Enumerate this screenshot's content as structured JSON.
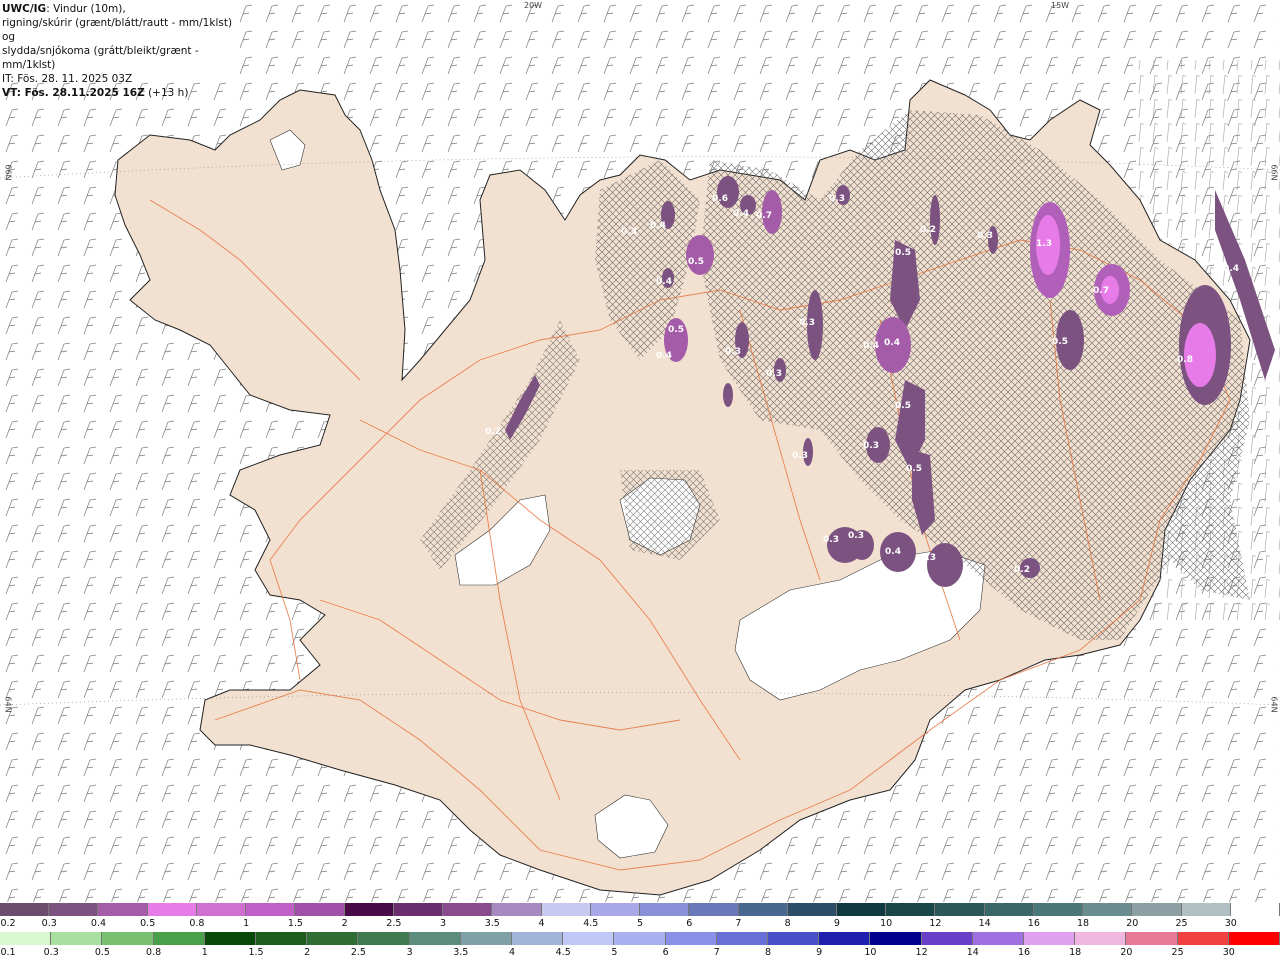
{
  "header": {
    "model": "UWC/IG",
    "line1_rest": ": Vindur (10m),",
    "line2": "rigning/skúrir (grænt/blátt/rautt - mm/1klst) og",
    "line3": "slydda/snjókoma (grátt/bleikt/grænt - mm/1klst)",
    "line4": "IT: Fös. 28. 11. 2025 03Z",
    "line5_bold": "VT: Fös. 28.11.2025 16Z",
    "line5_rest": " (+13 h)"
  },
  "grid_labels": {
    "top_20w": "20W",
    "top_15w": "15W",
    "left_66n": "66N",
    "left_64n": "64N",
    "right_66n": "66N",
    "right_64n": "64N"
  },
  "precip_values": [
    "0.6",
    "0.4",
    "0.7",
    "0.3",
    "0.5",
    "0.5",
    "1.3",
    "0.7",
    "0.5",
    "0.8",
    "0.4",
    "0.4",
    "0.5",
    "0.4",
    "0.4",
    "0.4",
    "0.3",
    "0.3",
    "0.3",
    "0.3",
    "0.3",
    "0.5",
    "0.5",
    "0.3",
    "0.3",
    "0.4",
    "0.3",
    "0.2",
    "0.2",
    "0.3",
    "0.2",
    "0.4",
    "0.3"
  ],
  "legend_snow": {
    "labels": [
      "0.2",
      "0.3",
      "0.4",
      "0.5",
      "0.8",
      "1",
      "1.5",
      "2",
      "2.5",
      "3",
      "3.5",
      "4",
      "4.5",
      "5",
      "6",
      "7",
      "8",
      "9",
      "10",
      "12",
      "14",
      "16",
      "18",
      "20",
      "25",
      "30"
    ],
    "colors": [
      "#6b4c6e",
      "#7c5380",
      "#a45ba8",
      "#e77ce8",
      "#d070d0",
      "#c060c8",
      "#a050a8",
      "#4a0a48",
      "#6a2e6e",
      "#8a4a8e",
      "#a888c0",
      "#c8c8f0",
      "#a8a8e8",
      "#8890d8",
      "#6878b8",
      "#486890",
      "#2c4e66",
      "#103840",
      "#1a4848",
      "#2a5858",
      "#3a6868",
      "#4a7878",
      "#6a8c8e",
      "#8ca0a4",
      "#b0c0c2",
      "#ffffff"
    ]
  },
  "legend_rain": {
    "labels": [
      "0.1",
      "0.3",
      "0.5",
      "0.8",
      "1",
      "1.5",
      "2",
      "2.5",
      "3",
      "3.5",
      "4",
      "4.5",
      "5",
      "6",
      "7",
      "8",
      "9",
      "10",
      "12",
      "14",
      "16",
      "18",
      "20",
      "25",
      "30"
    ],
    "colors": [
      "#d8f8d0",
      "#a8e0a0",
      "#78c070",
      "#48a048",
      "#084808",
      "#1c5c1c",
      "#2e6e34",
      "#3e7c50",
      "#5c8c7c",
      "#80a0a8",
      "#a0b4d8",
      "#c0c8f8",
      "#a8b0f0",
      "#8890e8",
      "#6870d8",
      "#4850c8",
      "#2020b0",
      "#000090",
      "#6a40c8",
      "#a070e0",
      "#e0a0f0",
      "#f0b8e0",
      "#e87898",
      "#f04040",
      "#ff0000"
    ]
  }
}
